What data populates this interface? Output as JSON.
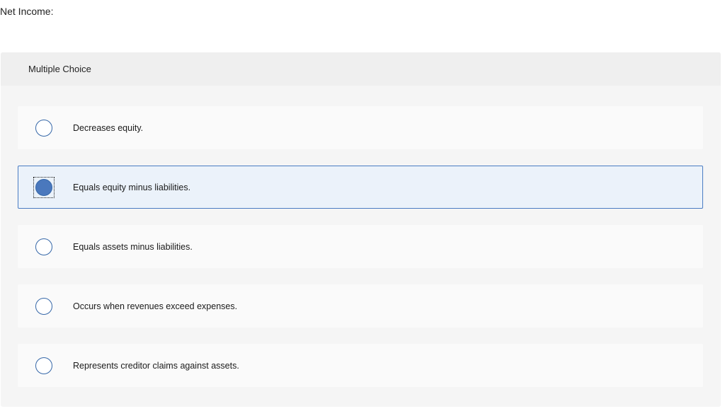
{
  "question": {
    "prompt": "Net Income:"
  },
  "multiple_choice": {
    "header": "Multiple Choice",
    "options": [
      {
        "label": "Decreases equity.",
        "selected": false
      },
      {
        "label": "Equals equity minus liabilities.",
        "selected": true
      },
      {
        "label": "Equals assets minus liabilities.",
        "selected": false
      },
      {
        "label": "Occurs when revenues exceed expenses.",
        "selected": false
      },
      {
        "label": "Represents creditor claims against assets.",
        "selected": false
      }
    ]
  },
  "colors": {
    "accent": "#4a78bd",
    "selected_background": "#ebf2fa",
    "panel_background": "#f5f5f5"
  }
}
